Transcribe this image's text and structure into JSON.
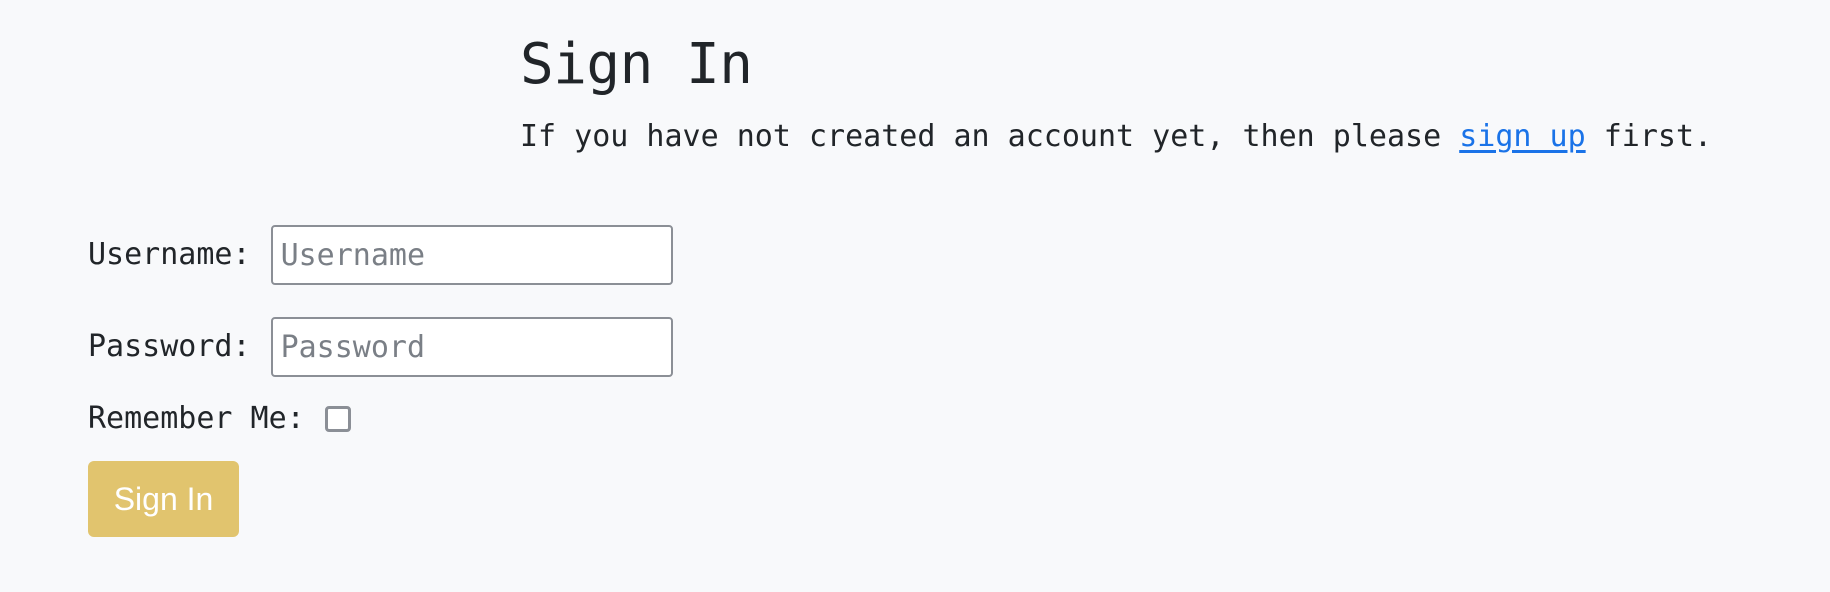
{
  "header": {
    "title": "Sign In",
    "intro_before": "If you have not created an account yet, then please ",
    "signup_link": "sign up",
    "intro_after": " first."
  },
  "form": {
    "username_label": "Username:",
    "username_placeholder": "Username",
    "username_value": "",
    "password_label": "Password:",
    "password_placeholder": "Password",
    "password_value": "",
    "remember_label": "Remember Me:",
    "remember_checked": false,
    "submit_label": "Sign In"
  },
  "colors": {
    "background": "#f8f9fb",
    "link": "#1a73e8",
    "button": "#e1c46e",
    "button_text": "#ffffff",
    "input_border": "#8b8f96"
  }
}
